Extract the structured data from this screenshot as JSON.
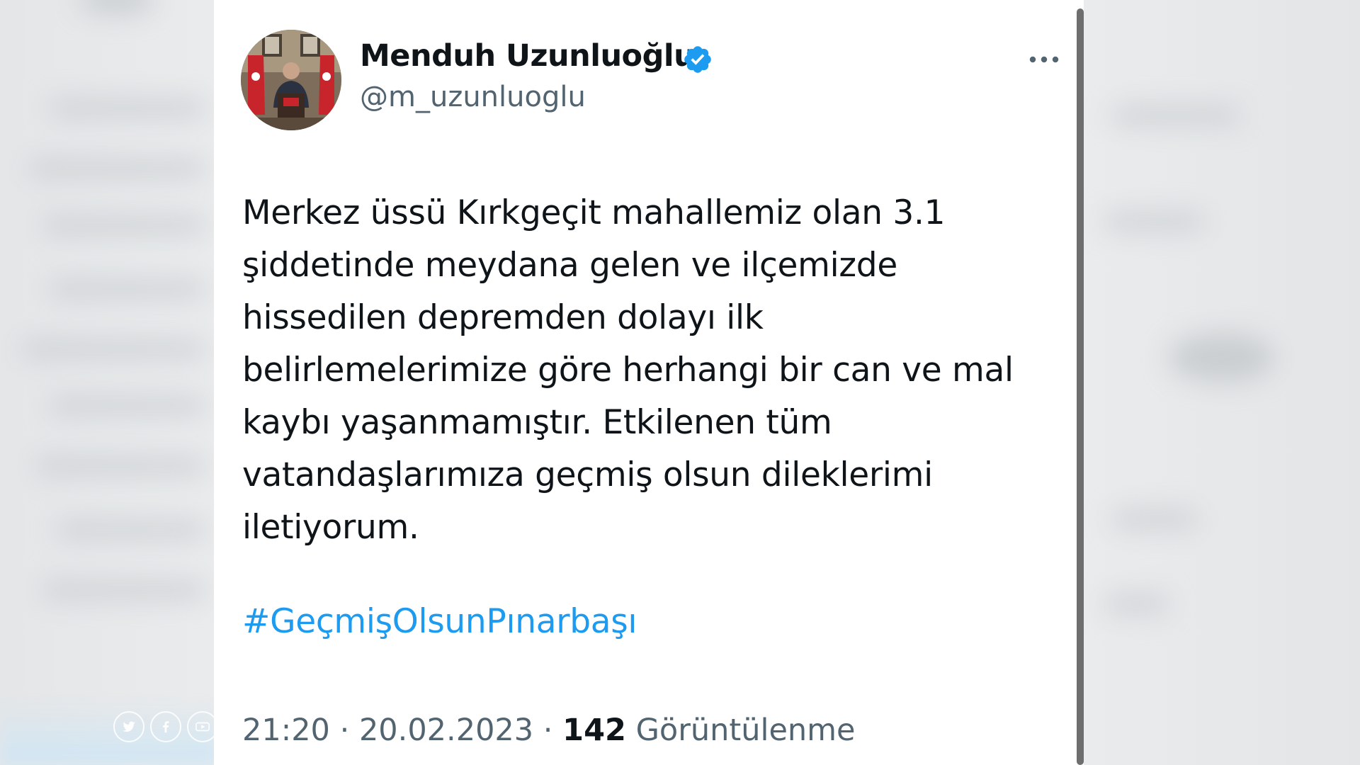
{
  "tweet": {
    "author": {
      "display_name": "Menduh Uzunluoğlu",
      "handle": "@m_uzunluoglu",
      "verified": true
    },
    "body_lines": [
      "Merkez üssü Kırkgeçit mahallemiz olan 3.1",
      "şiddetinde meydana gelen ve ilçemizde",
      "hissedilen depremden dolayı ilk",
      "belirlemelerimize göre herhangi bir can ve mal",
      "kaybı yaşanmamıştır. Etkilenen tüm",
      "vatandaşlarımıza geçmiş olsun dileklerimi",
      "iletiyorum."
    ],
    "hashtag": "#GeçmişOlsunPınarbaşı",
    "time": "21:20",
    "separator": " · ",
    "date": "20.02.2023",
    "views_count": "142",
    "views_label": "Görüntülenme"
  },
  "icons": {
    "verified": "verified-badge-icon",
    "more": "more-options-icon",
    "social": [
      "twitter-icon",
      "facebook-icon",
      "youtube-icon"
    ]
  },
  "colors": {
    "name": "#0f1419",
    "handle": "#536471",
    "hashtag": "#1d9bf0",
    "verified": "#1d9bf0",
    "card": "#ffffff"
  }
}
